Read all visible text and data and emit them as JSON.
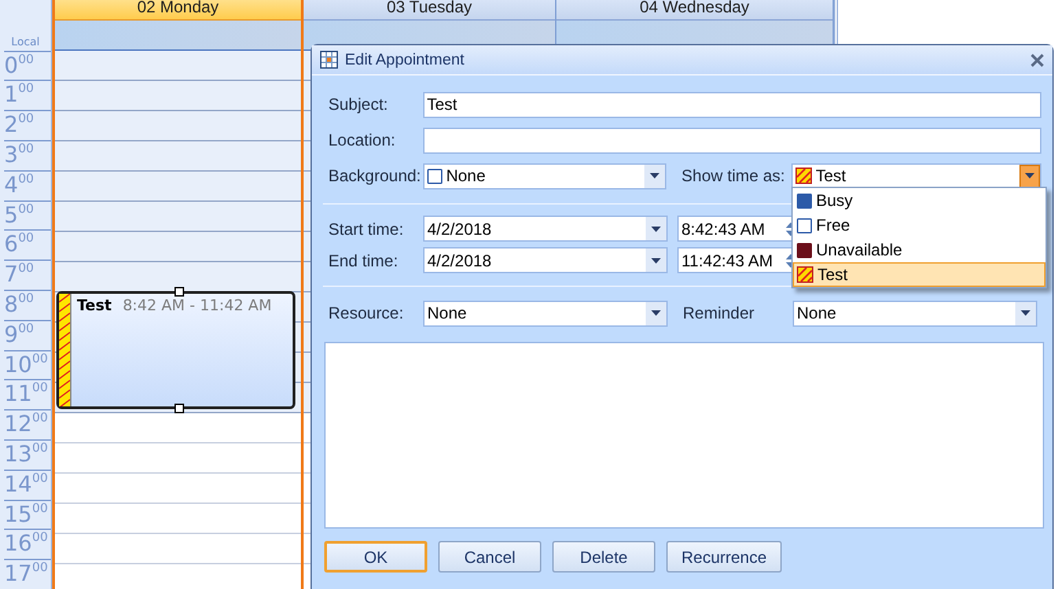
{
  "calendar": {
    "time_zone_label": "Local",
    "days": [
      {
        "label": "02 Monday",
        "selected": true
      },
      {
        "label": "03 Tuesday",
        "selected": false
      },
      {
        "label": "04 Wednesday",
        "selected": false
      }
    ],
    "hours": [
      {
        "hour": "0",
        "minutes": "00"
      },
      {
        "hour": "1",
        "minutes": "00"
      },
      {
        "hour": "2",
        "minutes": "00"
      },
      {
        "hour": "3",
        "minutes": "00"
      },
      {
        "hour": "4",
        "minutes": "00"
      },
      {
        "hour": "5",
        "minutes": "00"
      },
      {
        "hour": "6",
        "minutes": "00"
      },
      {
        "hour": "7",
        "minutes": "00"
      },
      {
        "hour": "8",
        "minutes": "00"
      },
      {
        "hour": "9",
        "minutes": "00"
      },
      {
        "hour": "10",
        "minutes": "00"
      },
      {
        "hour": "11",
        "minutes": "00"
      },
      {
        "hour": "12",
        "minutes": "00"
      },
      {
        "hour": "13",
        "minutes": "00"
      },
      {
        "hour": "14",
        "minutes": "00"
      },
      {
        "hour": "15",
        "minutes": "00"
      },
      {
        "hour": "16",
        "minutes": "00"
      },
      {
        "hour": "17",
        "minutes": "00"
      }
    ],
    "appointment": {
      "subject": "Test",
      "time": "8:42 AM - 11:42 AM",
      "selected": true
    }
  },
  "dialog": {
    "title": "Edit Appointment",
    "subject": {
      "label": "Subject:",
      "value": "Test"
    },
    "location": {
      "label": "Location:"
    },
    "background": {
      "label": "Background:",
      "value": "None",
      "color": "#ffffff"
    },
    "show_time_as": {
      "label": "Show time as:",
      "value": "Test",
      "expanded": true,
      "options": [
        {
          "label": "Busy",
          "kind": "solid",
          "color": "#2c5aa8",
          "selected": false
        },
        {
          "label": "Free",
          "kind": "solid",
          "color": "#ffffff",
          "selected": false
        },
        {
          "label": "Unavailable",
          "kind": "solid",
          "color": "#6b0f1a",
          "selected": false
        },
        {
          "label": "Test",
          "kind": "hatched",
          "color": "#ffd800",
          "selected": true
        }
      ]
    },
    "start_time": {
      "label": "Start time:",
      "date": "4/2/2018",
      "time": "8:42:43 AM"
    },
    "end_time": {
      "label": "End time:",
      "date": "4/2/2018",
      "time": "11:42:43 AM"
    },
    "resource": {
      "label": "Resource:",
      "value": "None"
    },
    "reminder": {
      "label": "Reminder",
      "value": "None"
    },
    "buttons": [
      {
        "label": "OK",
        "default": true
      },
      {
        "label": "Cancel",
        "default": false
      },
      {
        "label": "Delete",
        "default": false
      },
      {
        "label": "Recurrence",
        "default": false
      }
    ]
  }
}
